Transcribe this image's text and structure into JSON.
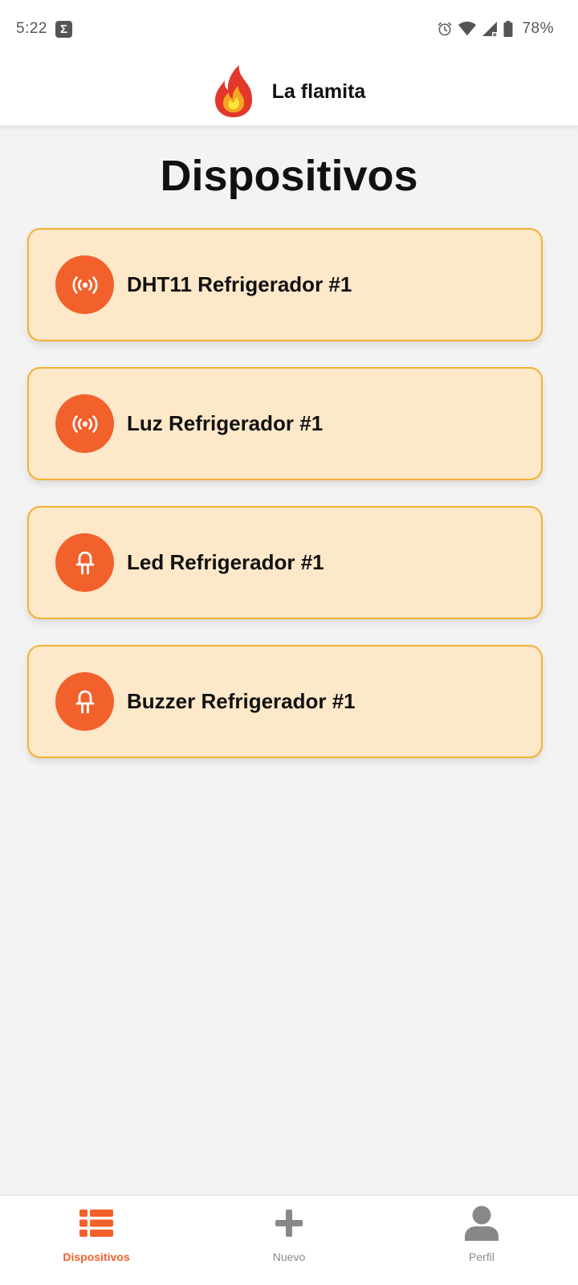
{
  "status_bar": {
    "time": "5:22",
    "notification_icon": "Σ",
    "battery": "78%"
  },
  "header": {
    "title": "La flamita",
    "logo_icon": "flame-icon"
  },
  "main": {
    "title": "Dispositivos",
    "devices": [
      {
        "name": "DHT11 Refrigerador #1",
        "icon": "sensor-broadcast-icon"
      },
      {
        "name": "Luz Refrigerador #1",
        "icon": "sensor-broadcast-icon"
      },
      {
        "name": "Led Refrigerador #1",
        "icon": "led-icon"
      },
      {
        "name": "Buzzer Refrigerador #1",
        "icon": "led-icon"
      }
    ]
  },
  "bottom_nav": {
    "items": [
      {
        "label": "Dispositivos",
        "icon": "list-icon",
        "active": true
      },
      {
        "label": "Nuevo",
        "icon": "plus-icon",
        "active": false
      },
      {
        "label": "Perfil",
        "icon": "user-icon",
        "active": false
      }
    ]
  },
  "colors": {
    "accent": "#f2612b",
    "card_background": "#fde8c9",
    "card_border": "#f4b030",
    "page_background": "#f2f2f2"
  }
}
